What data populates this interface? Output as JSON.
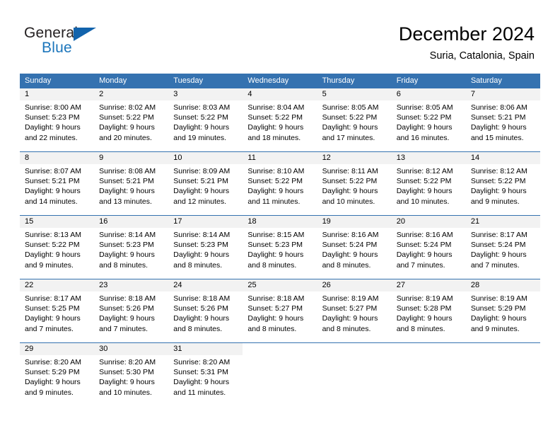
{
  "logo": {
    "word_one": "General",
    "word_two": "Blue",
    "triangle_color": "#1263ac",
    "blue_color": "#1b75bb"
  },
  "header": {
    "title": "December 2024",
    "subtitle": "Suria, Catalonia, Spain"
  },
  "theme": {
    "header_blue": "#3572b0",
    "day_band_gray": "#f2f2f2",
    "text_color": "#000000"
  },
  "weekdays": [
    "Sunday",
    "Monday",
    "Tuesday",
    "Wednesday",
    "Thursday",
    "Friday",
    "Saturday"
  ],
  "weeks": [
    [
      {
        "day": "1",
        "sunrise": "Sunrise: 8:00 AM",
        "sunset": "Sunset: 5:23 PM",
        "daylight_line1": "Daylight: 9 hours",
        "daylight_line2": "and 22 minutes."
      },
      {
        "day": "2",
        "sunrise": "Sunrise: 8:02 AM",
        "sunset": "Sunset: 5:22 PM",
        "daylight_line1": "Daylight: 9 hours",
        "daylight_line2": "and 20 minutes."
      },
      {
        "day": "3",
        "sunrise": "Sunrise: 8:03 AM",
        "sunset": "Sunset: 5:22 PM",
        "daylight_line1": "Daylight: 9 hours",
        "daylight_line2": "and 19 minutes."
      },
      {
        "day": "4",
        "sunrise": "Sunrise: 8:04 AM",
        "sunset": "Sunset: 5:22 PM",
        "daylight_line1": "Daylight: 9 hours",
        "daylight_line2": "and 18 minutes."
      },
      {
        "day": "5",
        "sunrise": "Sunrise: 8:05 AM",
        "sunset": "Sunset: 5:22 PM",
        "daylight_line1": "Daylight: 9 hours",
        "daylight_line2": "and 17 minutes."
      },
      {
        "day": "6",
        "sunrise": "Sunrise: 8:05 AM",
        "sunset": "Sunset: 5:22 PM",
        "daylight_line1": "Daylight: 9 hours",
        "daylight_line2": "and 16 minutes."
      },
      {
        "day": "7",
        "sunrise": "Sunrise: 8:06 AM",
        "sunset": "Sunset: 5:21 PM",
        "daylight_line1": "Daylight: 9 hours",
        "daylight_line2": "and 15 minutes."
      }
    ],
    [
      {
        "day": "8",
        "sunrise": "Sunrise: 8:07 AM",
        "sunset": "Sunset: 5:21 PM",
        "daylight_line1": "Daylight: 9 hours",
        "daylight_line2": "and 14 minutes."
      },
      {
        "day": "9",
        "sunrise": "Sunrise: 8:08 AM",
        "sunset": "Sunset: 5:21 PM",
        "daylight_line1": "Daylight: 9 hours",
        "daylight_line2": "and 13 minutes."
      },
      {
        "day": "10",
        "sunrise": "Sunrise: 8:09 AM",
        "sunset": "Sunset: 5:21 PM",
        "daylight_line1": "Daylight: 9 hours",
        "daylight_line2": "and 12 minutes."
      },
      {
        "day": "11",
        "sunrise": "Sunrise: 8:10 AM",
        "sunset": "Sunset: 5:22 PM",
        "daylight_line1": "Daylight: 9 hours",
        "daylight_line2": "and 11 minutes."
      },
      {
        "day": "12",
        "sunrise": "Sunrise: 8:11 AM",
        "sunset": "Sunset: 5:22 PM",
        "daylight_line1": "Daylight: 9 hours",
        "daylight_line2": "and 10 minutes."
      },
      {
        "day": "13",
        "sunrise": "Sunrise: 8:12 AM",
        "sunset": "Sunset: 5:22 PM",
        "daylight_line1": "Daylight: 9 hours",
        "daylight_line2": "and 10 minutes."
      },
      {
        "day": "14",
        "sunrise": "Sunrise: 8:12 AM",
        "sunset": "Sunset: 5:22 PM",
        "daylight_line1": "Daylight: 9 hours",
        "daylight_line2": "and 9 minutes."
      }
    ],
    [
      {
        "day": "15",
        "sunrise": "Sunrise: 8:13 AM",
        "sunset": "Sunset: 5:22 PM",
        "daylight_line1": "Daylight: 9 hours",
        "daylight_line2": "and 9 minutes."
      },
      {
        "day": "16",
        "sunrise": "Sunrise: 8:14 AM",
        "sunset": "Sunset: 5:23 PM",
        "daylight_line1": "Daylight: 9 hours",
        "daylight_line2": "and 8 minutes."
      },
      {
        "day": "17",
        "sunrise": "Sunrise: 8:14 AM",
        "sunset": "Sunset: 5:23 PM",
        "daylight_line1": "Daylight: 9 hours",
        "daylight_line2": "and 8 minutes."
      },
      {
        "day": "18",
        "sunrise": "Sunrise: 8:15 AM",
        "sunset": "Sunset: 5:23 PM",
        "daylight_line1": "Daylight: 9 hours",
        "daylight_line2": "and 8 minutes."
      },
      {
        "day": "19",
        "sunrise": "Sunrise: 8:16 AM",
        "sunset": "Sunset: 5:24 PM",
        "daylight_line1": "Daylight: 9 hours",
        "daylight_line2": "and 8 minutes."
      },
      {
        "day": "20",
        "sunrise": "Sunrise: 8:16 AM",
        "sunset": "Sunset: 5:24 PM",
        "daylight_line1": "Daylight: 9 hours",
        "daylight_line2": "and 7 minutes."
      },
      {
        "day": "21",
        "sunrise": "Sunrise: 8:17 AM",
        "sunset": "Sunset: 5:24 PM",
        "daylight_line1": "Daylight: 9 hours",
        "daylight_line2": "and 7 minutes."
      }
    ],
    [
      {
        "day": "22",
        "sunrise": "Sunrise: 8:17 AM",
        "sunset": "Sunset: 5:25 PM",
        "daylight_line1": "Daylight: 9 hours",
        "daylight_line2": "and 7 minutes."
      },
      {
        "day": "23",
        "sunrise": "Sunrise: 8:18 AM",
        "sunset": "Sunset: 5:26 PM",
        "daylight_line1": "Daylight: 9 hours",
        "daylight_line2": "and 7 minutes."
      },
      {
        "day": "24",
        "sunrise": "Sunrise: 8:18 AM",
        "sunset": "Sunset: 5:26 PM",
        "daylight_line1": "Daylight: 9 hours",
        "daylight_line2": "and 8 minutes."
      },
      {
        "day": "25",
        "sunrise": "Sunrise: 8:18 AM",
        "sunset": "Sunset: 5:27 PM",
        "daylight_line1": "Daylight: 9 hours",
        "daylight_line2": "and 8 minutes."
      },
      {
        "day": "26",
        "sunrise": "Sunrise: 8:19 AM",
        "sunset": "Sunset: 5:27 PM",
        "daylight_line1": "Daylight: 9 hours",
        "daylight_line2": "and 8 minutes."
      },
      {
        "day": "27",
        "sunrise": "Sunrise: 8:19 AM",
        "sunset": "Sunset: 5:28 PM",
        "daylight_line1": "Daylight: 9 hours",
        "daylight_line2": "and 8 minutes."
      },
      {
        "day": "28",
        "sunrise": "Sunrise: 8:19 AM",
        "sunset": "Sunset: 5:29 PM",
        "daylight_line1": "Daylight: 9 hours",
        "daylight_line2": "and 9 minutes."
      }
    ],
    [
      {
        "day": "29",
        "sunrise": "Sunrise: 8:20 AM",
        "sunset": "Sunset: 5:29 PM",
        "daylight_line1": "Daylight: 9 hours",
        "daylight_line2": "and 9 minutes."
      },
      {
        "day": "30",
        "sunrise": "Sunrise: 8:20 AM",
        "sunset": "Sunset: 5:30 PM",
        "daylight_line1": "Daylight: 9 hours",
        "daylight_line2": "and 10 minutes."
      },
      {
        "day": "31",
        "sunrise": "Sunrise: 8:20 AM",
        "sunset": "Sunset: 5:31 PM",
        "daylight_line1": "Daylight: 9 hours",
        "daylight_line2": "and 11 minutes."
      },
      {
        "day": "",
        "sunrise": "",
        "sunset": "",
        "daylight_line1": "",
        "daylight_line2": ""
      },
      {
        "day": "",
        "sunrise": "",
        "sunset": "",
        "daylight_line1": "",
        "daylight_line2": ""
      },
      {
        "day": "",
        "sunrise": "",
        "sunset": "",
        "daylight_line1": "",
        "daylight_line2": ""
      },
      {
        "day": "",
        "sunrise": "",
        "sunset": "",
        "daylight_line1": "",
        "daylight_line2": ""
      }
    ]
  ]
}
